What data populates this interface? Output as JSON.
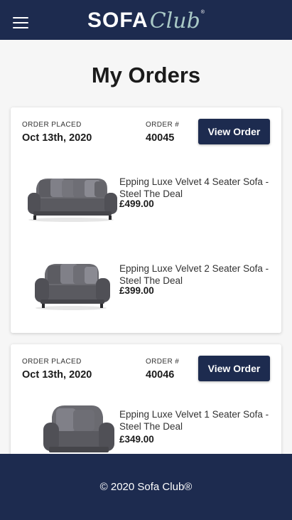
{
  "header": {
    "logo_main": "SOFA",
    "logo_script": "Club",
    "logo_mark": "®",
    "menu_icon": "hamburger-menu-icon"
  },
  "page": {
    "title": "My Orders"
  },
  "orders": [
    {
      "placed_label": "ORDER PLACED",
      "placed_date": "Oct 13th, 2020",
      "number_label": "ORDER #",
      "number": "40045",
      "button_label": "View Order",
      "items": [
        {
          "name": "Epping Luxe Velvet 4 Seater Sofa - Steel The Deal",
          "price": "£499.00",
          "image": "grey-4-seater-sofa-image"
        },
        {
          "name": "Epping Luxe Velvet 2 Seater Sofa - Steel The Deal",
          "price": "£399.00",
          "image": "grey-2-seater-sofa-image"
        }
      ]
    },
    {
      "placed_label": "ORDER PLACED",
      "placed_date": "Oct 13th, 2020",
      "number_label": "ORDER #",
      "number": "40046",
      "button_label": "View Order",
      "items": [
        {
          "name": "Epping Luxe Velvet 1 Seater Sofa - Steel The Deal",
          "price": "£349.00",
          "image": "grey-armchair-image"
        }
      ]
    }
  ],
  "footer": {
    "copyright": "© 2020 Sofa Club®"
  },
  "colors": {
    "navy": "#1d2b4f",
    "logo_script": "#a9c9c6",
    "background": "#f6f6f6"
  }
}
